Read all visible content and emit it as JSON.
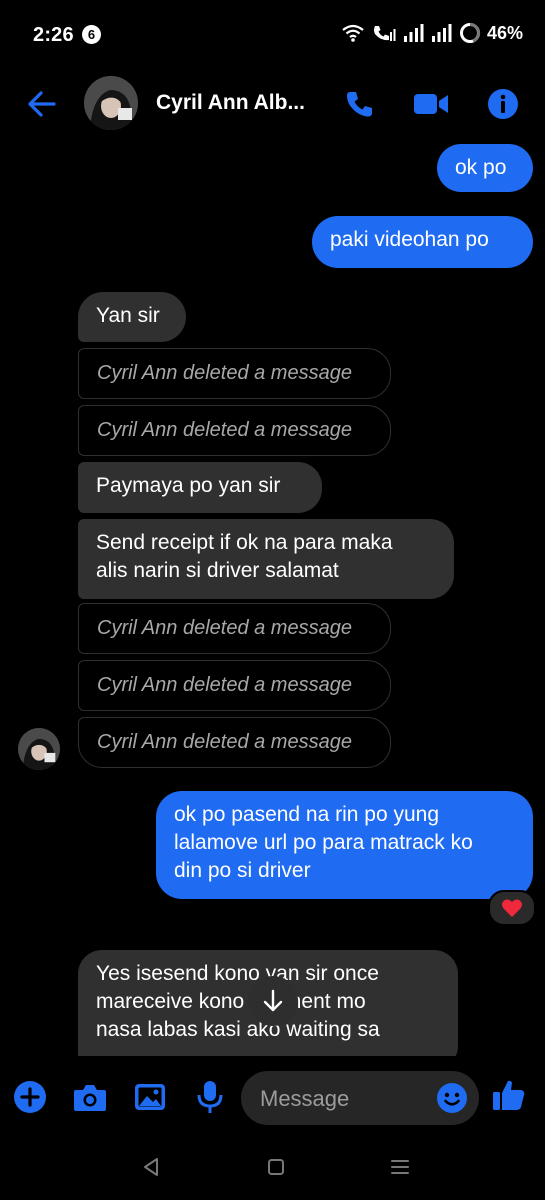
{
  "status_bar": {
    "time": "2:26",
    "notification_count": "6",
    "battery": "46%"
  },
  "header": {
    "contact_name": "Cyril Ann Alb...",
    "accent_color": "#1f6bf2"
  },
  "messages": [
    {
      "direction": "outgoing",
      "text": "ok po"
    },
    {
      "direction": "outgoing",
      "text": "paki videohan po"
    },
    {
      "direction": "incoming",
      "text": "Yan sir"
    },
    {
      "direction": "incoming",
      "type": "deleted",
      "text": "Cyril Ann deleted a message"
    },
    {
      "direction": "incoming",
      "type": "deleted",
      "text": "Cyril Ann deleted a message"
    },
    {
      "direction": "incoming",
      "text": "Paymaya po yan sir"
    },
    {
      "direction": "incoming",
      "lines": [
        "Send receipt if ok na para maka",
        "alis narin si driver salamat"
      ]
    },
    {
      "direction": "incoming",
      "type": "deleted",
      "text": "Cyril Ann deleted a message"
    },
    {
      "direction": "incoming",
      "type": "deleted",
      "text": "Cyril Ann deleted a message"
    },
    {
      "direction": "incoming",
      "type": "deleted",
      "text": "Cyril Ann deleted a message"
    },
    {
      "direction": "outgoing",
      "lines": [
        "ok po pasend na rin po yung",
        "lalamove url po para matrack ko",
        "din po si driver"
      ],
      "reaction": "heart"
    },
    {
      "direction": "incoming",
      "lines": [
        "Yes isesend kono yan sir once",
        "mareceive kono payment mo",
        "nasa labas kasi ako waiting sa"
      ]
    }
  ],
  "composer": {
    "placeholder": "Message"
  },
  "icons": {
    "back": "arrow-left-icon",
    "call": "phone-icon",
    "video": "video-camera-icon",
    "info": "info-icon",
    "add": "plus-circle-icon",
    "camera": "camera-icon",
    "gallery": "image-icon",
    "mic": "microphone-icon",
    "emoji": "emoji-icon",
    "like": "thumbs-up-icon"
  }
}
